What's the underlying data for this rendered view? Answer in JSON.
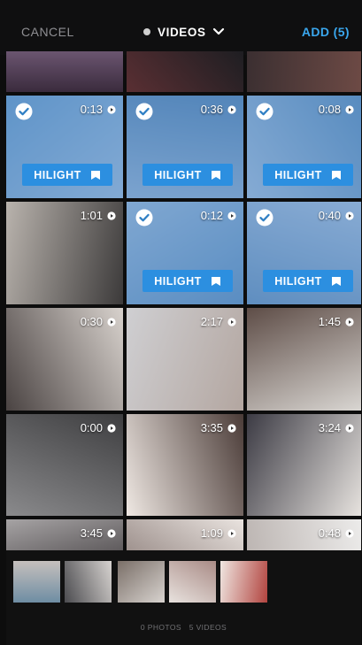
{
  "header": {
    "cancel_label": "CANCEL",
    "title": "VIDEOS",
    "add_label": "ADD (5)"
  },
  "colors": {
    "accent": "#3aa7ee",
    "hilight_bg": "#2c8fe0",
    "selected_overlay": "rgba(60,120,190,0.55)"
  },
  "grid": {
    "tiles": [
      {
        "duration": "",
        "selected": false,
        "hilight": ""
      },
      {
        "duration": "",
        "selected": false,
        "hilight": ""
      },
      {
        "duration": "",
        "selected": false,
        "hilight": ""
      },
      {
        "duration": "0:13",
        "selected": true,
        "hilight": "HILIGHT"
      },
      {
        "duration": "0:36",
        "selected": true,
        "hilight": "HILIGHT"
      },
      {
        "duration": "0:08",
        "selected": true,
        "hilight": "HILIGHT"
      },
      {
        "duration": "1:01",
        "selected": false,
        "hilight": ""
      },
      {
        "duration": "0:12",
        "selected": true,
        "hilight": "HILIGHT"
      },
      {
        "duration": "0:40",
        "selected": true,
        "hilight": "HILIGHT"
      },
      {
        "duration": "0:30",
        "selected": false,
        "hilight": ""
      },
      {
        "duration": "2:17",
        "selected": false,
        "hilight": ""
      },
      {
        "duration": "1:45",
        "selected": false,
        "hilight": ""
      },
      {
        "duration": "0:00",
        "selected": false,
        "hilight": ""
      },
      {
        "duration": "3:35",
        "selected": false,
        "hilight": ""
      },
      {
        "duration": "3:24",
        "selected": false,
        "hilight": ""
      },
      {
        "duration": "3:45",
        "selected": false,
        "hilight": ""
      },
      {
        "duration": "1:09",
        "selected": false,
        "hilight": ""
      },
      {
        "duration": "0:48",
        "selected": false,
        "hilight": ""
      }
    ]
  },
  "filmstrip": {
    "thumbs": 5,
    "photos_label": "0 PHOTOS",
    "videos_label": "5 VIDEOS"
  }
}
